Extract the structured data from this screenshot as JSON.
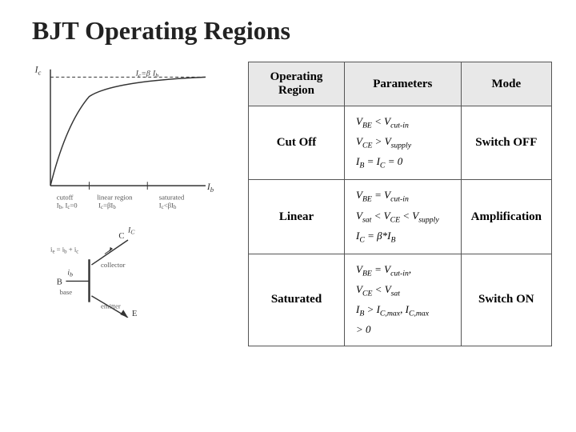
{
  "page": {
    "title": "BJT Operating Regions",
    "table": {
      "headers": [
        "Operating Region",
        "Parameters",
        "Mode"
      ],
      "rows": [
        {
          "region": "Cut Off",
          "params_html": "V<sub>BE</sub> &lt; V<sub>cut-in</sub><br>V<sub>CE</sub> &gt; V<sub>supply</sub><br>I<sub>B</sub> = I<sub>C</sub> = 0",
          "mode": "Switch OFF"
        },
        {
          "region": "Linear",
          "params_html": "V<sub>BE</sub> = V<sub>cut-in</sub><br>V<sub>sat</sub> &lt; V<sub>CE</sub> &lt; V<sub>supply</sub><br>I<sub>C</sub> = &beta;*I<sub>B</sub>",
          "mode": "Amplification"
        },
        {
          "region": "Saturated",
          "params_html": "V<sub>BE</sub> = V<sub>cut-in</sub>,<br>V<sub>CE</sub> &lt; V<sub>sat</sub><br>I<sub>B</sub> &gt; I<sub>C,max</sub>, I<sub>C,max</sub><br>&gt; 0",
          "mode": "Switch ON"
        }
      ]
    }
  }
}
